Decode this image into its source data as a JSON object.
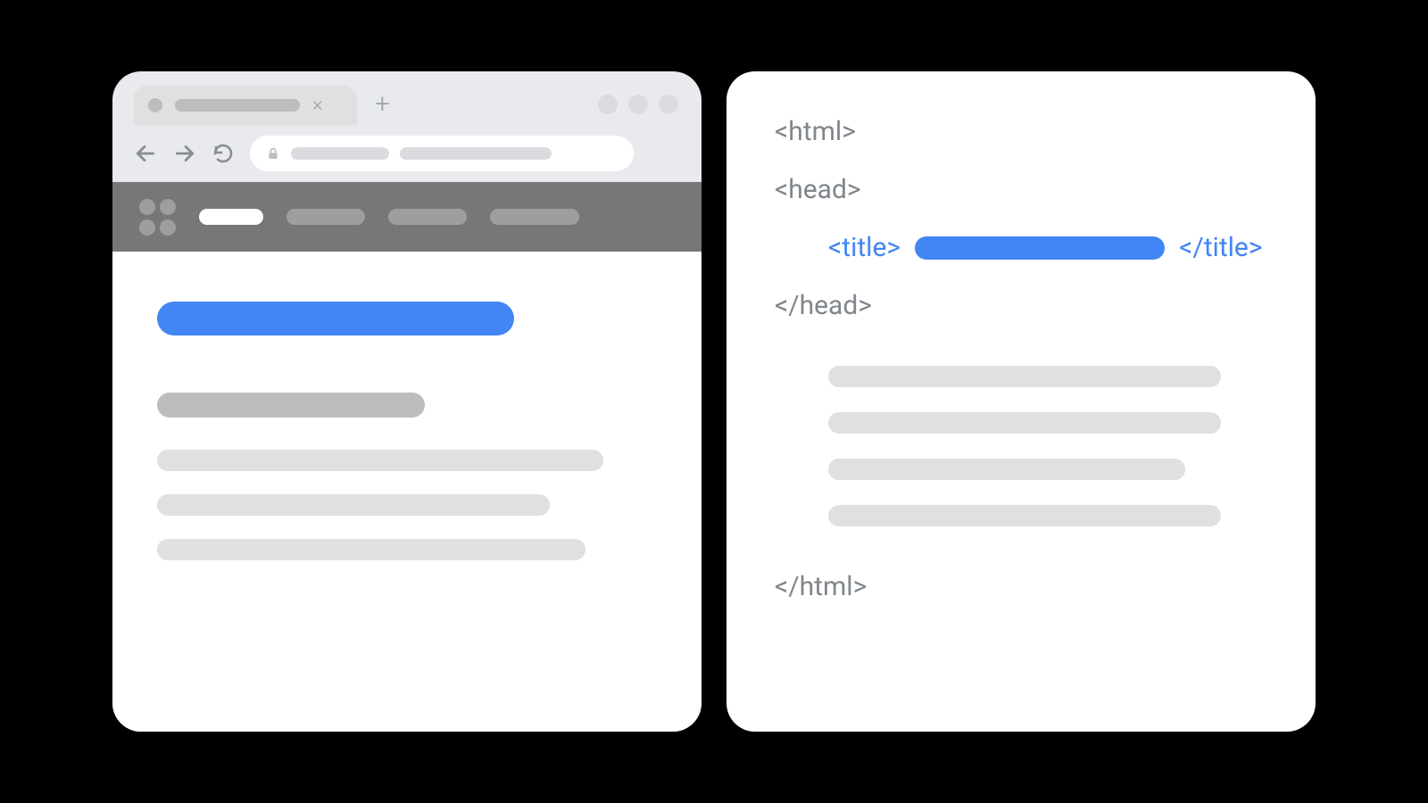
{
  "colors": {
    "accent_blue": "#4285f4",
    "gray_text": "#80868b",
    "gray_mid": "#bdbdbd",
    "gray_light": "#e0e0e0",
    "header_dark": "#777777"
  },
  "browser": {
    "tab_close_glyph": "×",
    "new_tab_glyph": "+"
  },
  "code": {
    "lines": {
      "html_open": "<html>",
      "head_open": "<head>",
      "title_open": "<title>",
      "title_close": "</title>",
      "head_close": "</head>",
      "html_close": "</html>"
    }
  }
}
